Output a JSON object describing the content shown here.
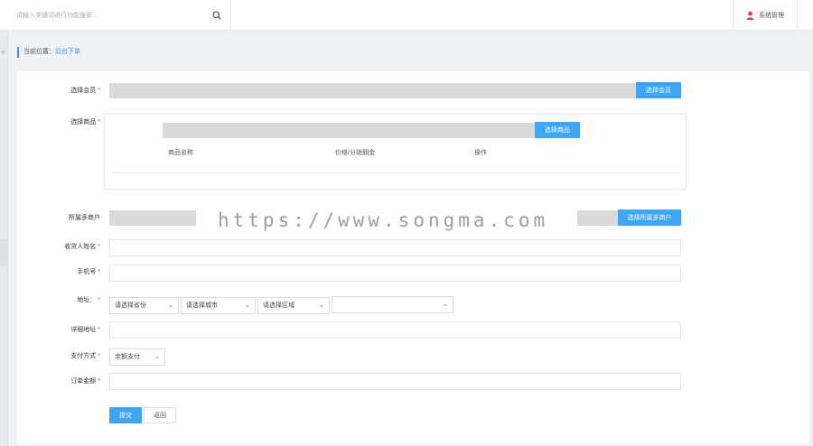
{
  "topbar": {
    "search_placeholder": "请输入关键词进行功能搜索...",
    "system_admin_label": "系统管理"
  },
  "breadcrumb": {
    "prefix": "当前位置：",
    "current": "后台下单"
  },
  "form": {
    "select_member": {
      "label": "选择会员",
      "button": "选择会员"
    },
    "select_goods": {
      "label": "选择商品",
      "button": "选择商品",
      "columns": [
        "商品名称",
        "价格/分销佣金",
        "操作"
      ]
    },
    "merchant": {
      "label": "所属多商户",
      "button": "选择所属多商户"
    },
    "receiver_name": {
      "label": "收货人姓名",
      "value": ""
    },
    "phone": {
      "label": "手机号",
      "value": ""
    },
    "address": {
      "label": "地址：",
      "province": "请选择省份",
      "city": "请选择城市",
      "district": "请选择区域",
      "extra": ""
    },
    "detail_address": {
      "label": "详细地址",
      "value": ""
    },
    "payment": {
      "label": "支付方式",
      "selected": "余额支付"
    },
    "order_amount": {
      "label": "订单金额",
      "value": ""
    },
    "submit_label": "提交",
    "return_label": "返回"
  },
  "watermark": "https://www.songma.com",
  "colors": {
    "accent": "#3fa6f4",
    "required": "#e64242",
    "breadcrumb": "#3c8ee6"
  }
}
